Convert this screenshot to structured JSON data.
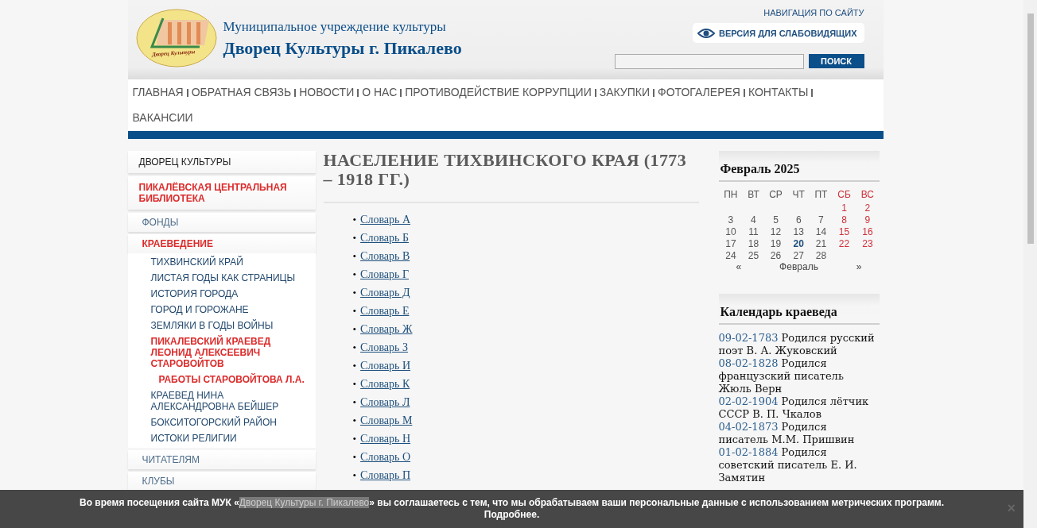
{
  "header": {
    "logo_text": "Дворец Культуры",
    "subtitle": "Муниципальное учреждение культуры",
    "title": "Дворец Культуры г. Пикалево",
    "site_nav_link": "НАВИГАЦИЯ ПО САЙТУ",
    "accessibility_button": "ВЕРСИЯ ДЛЯ СЛАБОВИДЯЩИХ",
    "search_button": "ПОИСК"
  },
  "menu": [
    {
      "label": "ГЛАВНАЯ"
    },
    {
      "label": "ОБРАТНАЯ СВЯЗЬ"
    },
    {
      "label": "НОВОСТИ"
    },
    {
      "label": "О НАС"
    },
    {
      "label": "ПРОТИВОДЕЙСТВИЕ КОРРУПЦИИ"
    },
    {
      "label": "ЗАКУПКИ"
    },
    {
      "label": "ФОТОГАЛЕРЕЯ"
    },
    {
      "label": "КОНТАКТЫ"
    },
    {
      "label": "ВАКАНСИИ"
    }
  ],
  "sidebar": {
    "items": [
      {
        "label": "ДВОРЕЦ КУЛЬТУРЫ",
        "selected": false
      },
      {
        "label": "ПИКАЛЁВСКАЯ ЦЕНТРАЛЬНАЯ БИБЛИОТЕКА",
        "selected": true,
        "children": [
          {
            "label": "ФОНДЫ",
            "selected": false
          },
          {
            "label": "КРАЕВЕДЕНИЕ",
            "selected": true,
            "children": [
              {
                "label": "ТИХВИНСКИЙ КРАЙ",
                "selected": false
              },
              {
                "label": "ЛИСТАЯ ГОДЫ КАК СТРАНИЦЫ",
                "selected": false
              },
              {
                "label": "ИСТОРИЯ ГОРОДА",
                "selected": false
              },
              {
                "label": "ГОРОД И ГОРОЖАНЕ",
                "selected": false
              },
              {
                "label": "ЗЕМЛЯКИ В ГОДЫ ВОЙНЫ",
                "selected": false
              },
              {
                "label": "ПИКАЛЕВСКИЙ КРАЕВЕД ЛЕОНИД АЛЕКСЕЕВИЧ СТАРОВОЙТОВ",
                "selected": true,
                "children": [
                  {
                    "label": "РАБОТЫ СТАРОВОЙТОВА Л.А.",
                    "selected": true
                  }
                ]
              },
              {
                "label": "КРАЕВЕД НИНА АЛЕКСАНДРОВНА БЕЙШЕР",
                "selected": false
              },
              {
                "label": "БОКСИТОГОРСКИЙ РАЙОН",
                "selected": false
              },
              {
                "label": "ИСТОКИ РЕЛИГИИ",
                "selected": false
              }
            ]
          },
          {
            "label": "ЧИТАТЕЛЯМ",
            "selected": false
          },
          {
            "label": "КЛУБЫ",
            "selected": false
          }
        ]
      }
    ]
  },
  "article": {
    "title": "НАСЕЛЕНИЕ ТИХВИНСКОГО КРАЯ (1773 – 1918 ГГ.)",
    "bullet": "•",
    "links": [
      "Словарь А",
      "Словарь Б",
      "Словарь В",
      "Словарь Г",
      "Словарь Д",
      "Словарь Е",
      "Словарь Ж",
      "Словарь З",
      "Словарь И",
      "Словарь К",
      "Словарь Л",
      "Словарь М",
      "Словарь Н",
      "Словарь О",
      "Словарь П"
    ]
  },
  "calendar": {
    "title": "Февраль 2025",
    "weekdays": [
      {
        "label": "ПН",
        "weekend": false
      },
      {
        "label": "ВТ",
        "weekend": false
      },
      {
        "label": "СР",
        "weekend": false
      },
      {
        "label": "ЧТ",
        "weekend": false
      },
      {
        "label": "ПТ",
        "weekend": false
      },
      {
        "label": "СБ",
        "weekend": true
      },
      {
        "label": "ВС",
        "weekend": true
      }
    ],
    "weeks": [
      [
        {
          "day": "1",
          "weekend": true,
          "today": false
        },
        {
          "day": "2",
          "weekend": true,
          "today": false
        }
      ],
      [
        {
          "day": "3",
          "weekend": false,
          "today": false
        },
        {
          "day": "4",
          "weekend": false,
          "today": false
        },
        {
          "day": "5",
          "weekend": false,
          "today": false
        },
        {
          "day": "6",
          "weekend": false,
          "today": false
        },
        {
          "day": "7",
          "weekend": false,
          "today": false
        },
        {
          "day": "8",
          "weekend": true,
          "today": false
        },
        {
          "day": "9",
          "weekend": true,
          "today": false
        }
      ],
      [
        {
          "day": "10",
          "weekend": false,
          "today": false
        },
        {
          "day": "11",
          "weekend": false,
          "today": false
        },
        {
          "day": "12",
          "weekend": false,
          "today": false
        },
        {
          "day": "13",
          "weekend": false,
          "today": false
        },
        {
          "day": "14",
          "weekend": false,
          "today": false
        },
        {
          "day": "15",
          "weekend": true,
          "today": false
        },
        {
          "day": "16",
          "weekend": true,
          "today": false
        }
      ],
      [
        {
          "day": "17",
          "weekend": false,
          "today": false
        },
        {
          "day": "18",
          "weekend": false,
          "today": false
        },
        {
          "day": "19",
          "weekend": false,
          "today": false
        },
        {
          "day": "20",
          "weekend": false,
          "today": true
        },
        {
          "day": "21",
          "weekend": false,
          "today": false
        },
        {
          "day": "22",
          "weekend": true,
          "today": false
        },
        {
          "day": "23",
          "weekend": true,
          "today": false
        }
      ],
      [
        {
          "day": "24",
          "weekend": false,
          "today": false
        },
        {
          "day": "25",
          "weekend": false,
          "today": false
        },
        {
          "day": "26",
          "weekend": false,
          "today": false
        },
        {
          "day": "27",
          "weekend": false,
          "today": false
        },
        {
          "day": "28",
          "weekend": false,
          "today": false
        }
      ]
    ],
    "prev": "«",
    "month": "Февраль",
    "next": "»"
  },
  "local_history": {
    "title": "Календарь краеведа",
    "events": [
      {
        "date": "09-02-1783",
        "text": "Родился русский поэт В. А. Жуковский"
      },
      {
        "date": "08-02-1828",
        "text": "Родился французский писатель Жюль Верн"
      },
      {
        "date": "02-02-1904",
        "text": "Родился лётчик СССР В. П. Чкалов"
      },
      {
        "date": "04-02-1873",
        "text": "Родился писатель М.М. Пришвин"
      },
      {
        "date": "01-02-1884",
        "text": "Родился советский писатель Е. И. Замятин"
      }
    ]
  },
  "cookie_notice": {
    "before": "Во время посещения сайта МУК «",
    "link": "Дворец Культуры г. Пикалево",
    "after": "» вы соглашаетесь с тем, что мы обрабатываем ваши персональные данные с использованием метрических программ.",
    "more_link": "Подробнее",
    "more_after": ".",
    "close": "×"
  }
}
